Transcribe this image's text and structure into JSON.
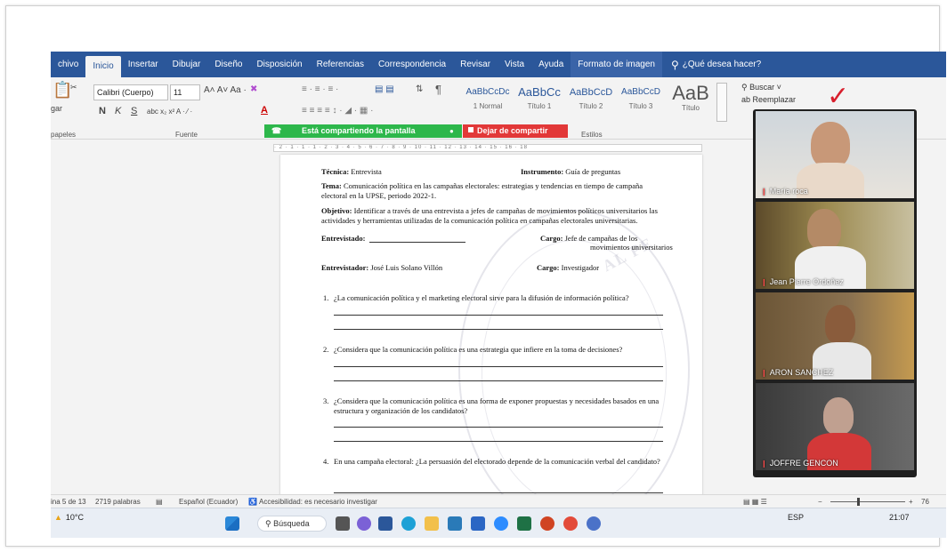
{
  "ribbon_tabs": [
    "chivo",
    "Inicio",
    "Insertar",
    "Dibujar",
    "Diseño",
    "Disposición",
    "Referencias",
    "Correspondencia",
    "Revisar",
    "Vista",
    "Ayuda",
    "Formato de imagen"
  ],
  "help_text": "¿Qué desea hacer?",
  "font": {
    "name": "Calibri (Cuerpo)",
    "size": "11",
    "group_label": "Fuente",
    "clipboard_label": "papeles",
    "paste_label": "gar"
  },
  "styles": [
    {
      "sample": "AaBbCcDc",
      "name": "1 Normal"
    },
    {
      "sample": "AaBbCc",
      "name": "Título 1"
    },
    {
      "sample": "AaBbCcD",
      "name": "Título 2"
    },
    {
      "sample": "AaBbCcD",
      "name": "Título 3"
    },
    {
      "sample": "AaB",
      "name": "Título"
    }
  ],
  "styles_label": "Estilos",
  "search": {
    "buscar": "Buscar",
    "reemplazar": "Reemplazar"
  },
  "share": {
    "status": "Está compartiendo la pantalla",
    "stop": "Dejar de compartir"
  },
  "ruler_text": "· 2 · 1 · 1 · 1 · 2 · 3 · 4 · 5 · 6 · 7 · 8 · 9 · 10 · 11 · 12 · 13 · 14 · 15 · 16 · 18",
  "document": {
    "tecnica_label": "Técnica:",
    "tecnica": "Entrevista",
    "instrumento_label": "Instrumento:",
    "instrumento": "Guía de preguntas",
    "tema_label": "Tema:",
    "tema": "Comunicación política en las campañas electorales: estrategias y tendencias en tiempo de campaña electoral en la UPSE, periodo 2022-1.",
    "objetivo_label": "Objetivo:",
    "objetivo": "Identificar a través de una entrevista a jefes de campañas de movimientos políticos universitarios las actividades y herramientas utilizadas de la comunicación política en campañas electorales universitarias.",
    "entrevistado_label": "Entrevistado:",
    "cargo1_label": "Cargo:",
    "cargo1_a": "Jefe de campañas de los",
    "cargo1_b": "movimientos universitarios",
    "entrevistador_label": "Entrevistador:",
    "entrevistador": "José Luis Solano Villón",
    "cargo2_label": "Cargo:",
    "cargo2": "Investigador",
    "questions": [
      {
        "n": "1.",
        "text": "¿La comunicación política y el marketing electoral sirve para la difusión de información política?"
      },
      {
        "n": "2.",
        "text": "¿Considera que la comunicación política es una estrategia que infiere en la toma de decisiones?"
      },
      {
        "n": "3.",
        "text": "¿Considera que la comunicación política es una forma de exponer propuestas y necesidades basados en una estructura y organización de los candidatos?"
      },
      {
        "n": "4.",
        "text": "En una campaña electoral: ¿La persuasión del electorado depende de la comunicación verbal del candidato?"
      }
    ]
  },
  "participants": [
    "María roca",
    "Jean Pierre Ordoñez",
    "ARON SANCHEZ",
    "JOFFRE GENCON"
  ],
  "status": {
    "page": "ina 5 de 13",
    "words": "2719 palabras",
    "language": "Español (Ecuador)",
    "accessibility": "Accesibilidad: es necesario investigar",
    "zoom": "76"
  },
  "taskbar": {
    "temp": "10°C",
    "search": "Búsqueda",
    "lang": "ESP",
    "time": "21:07"
  }
}
